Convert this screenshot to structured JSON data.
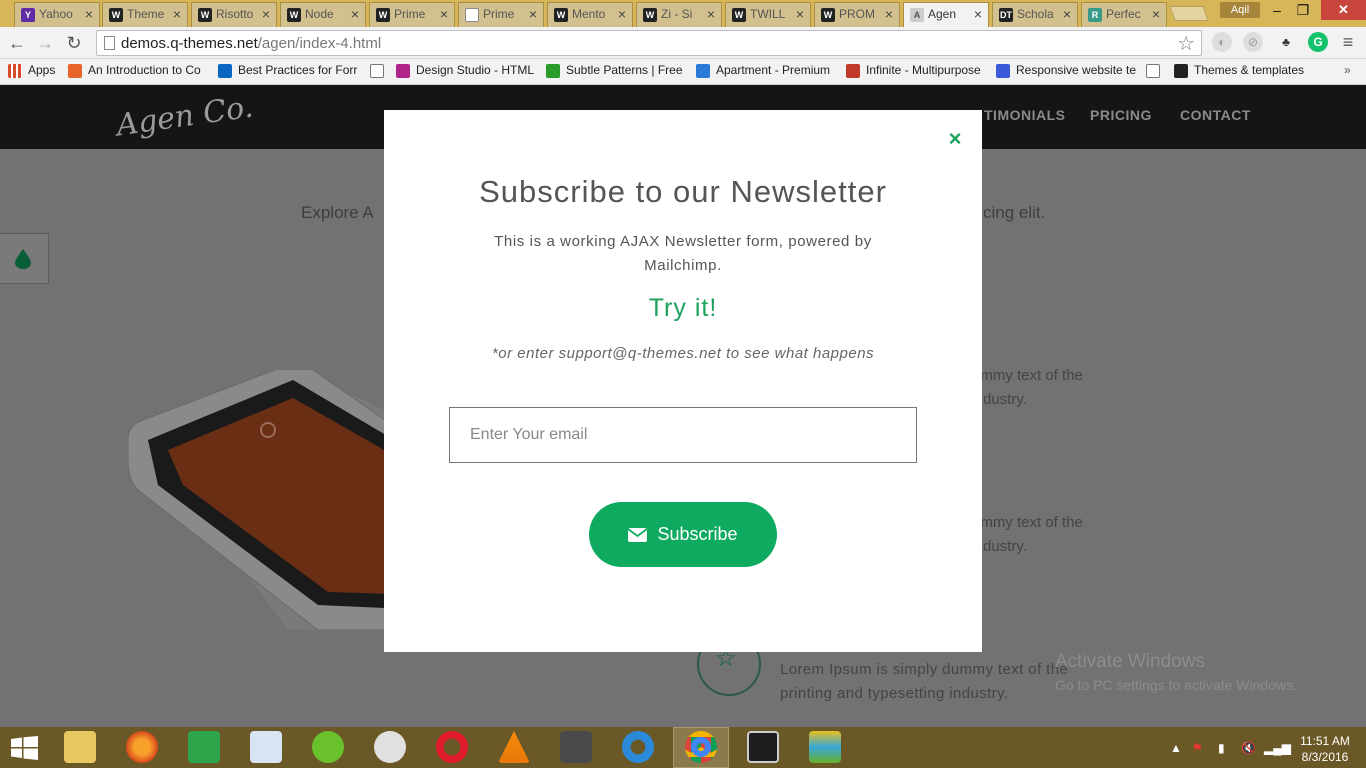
{
  "browser": {
    "tabs": [
      {
        "label": "Yahoo",
        "fav": "Y",
        "fav_color": "#5f2ca5"
      },
      {
        "label": "Theme",
        "fav": "W",
        "fav_color": "#222222"
      },
      {
        "label": "Risotto",
        "fav": "W",
        "fav_color": "#222222"
      },
      {
        "label": "Node",
        "fav": "W",
        "fav_color": "#222222"
      },
      {
        "label": "Prime",
        "fav": "W",
        "fav_color": "#222222"
      },
      {
        "label": "Prime",
        "fav": "",
        "fav_color": "#ffffff"
      },
      {
        "label": "Mento",
        "fav": "W",
        "fav_color": "#222222"
      },
      {
        "label": "Zi - Si",
        "fav": "W",
        "fav_color": "#222222"
      },
      {
        "label": "TWILL",
        "fav": "W",
        "fav_color": "#222222"
      },
      {
        "label": "PROM",
        "fav": "W",
        "fav_color": "#222222"
      },
      {
        "label": "Agen",
        "fav": "A",
        "fav_color": "#9a9a9a"
      },
      {
        "label": "Schola",
        "fav": "DT",
        "fav_color": "#222222"
      },
      {
        "label": "Perfec",
        "fav": "R",
        "fav_color": "#3a9a8a"
      }
    ],
    "user": "Aqil",
    "url_domain": "demos.q-themes.net",
    "url_path": "/agen/index-4.html",
    "bookmarks": [
      {
        "label": "Apps",
        "color": "#d94a2a"
      },
      {
        "label": "An Introduction to Co",
        "color": "#e8632a"
      },
      {
        "label": "Best Practices for Forr",
        "color": "#0a66c2"
      },
      {
        "label": "",
        "color": "#ffffff"
      },
      {
        "label": "Design Studio - HTML",
        "color": "#b0248a"
      },
      {
        "label": "Subtle Patterns | Free",
        "color": "#2a9a2a"
      },
      {
        "label": "Apartment - Premium",
        "color": "#2a7ad9"
      },
      {
        "label": "Infinite - Multipurpose",
        "color": "#c0392b"
      },
      {
        "label": "Responsive website te",
        "color": "#3a5ad9"
      },
      {
        "label": "",
        "color": "#ffffff"
      },
      {
        "label": "Themes & templates",
        "color": "#222222"
      }
    ]
  },
  "site": {
    "logo": "Agen Co.",
    "nav": [
      "TIMONIALS",
      "PRICING",
      "CONTACT"
    ],
    "intro_left": "Explore A",
    "intro_right": "cing elit.",
    "feature_lines": [
      {
        "a": "ummy text of the",
        "b": "dustry."
      },
      {
        "a": "ummy text of the",
        "b": "dustry."
      }
    ],
    "bottom_line_1": "Lorem Ipsum is simply dummy text of the",
    "bottom_line_2": "printing and typesetting industry."
  },
  "modal": {
    "close_symbol": "×",
    "title": "Subscribe to our Newsletter",
    "description": "This is a working AJAX Newsletter form, powered by Mailchimp.",
    "try_it": "Try it!",
    "note": "*or enter support@q-themes.net to see what happens",
    "email_placeholder": "Enter Your email",
    "email_value": "",
    "subscribe_label": "Subscribe",
    "accent_color": "#0daa60"
  },
  "os": {
    "watermark_title": "Activate Windows",
    "watermark_sub": "Go to PC settings to activate Windows.",
    "clock_time": "11:51 AM",
    "clock_date": "8/3/2016"
  }
}
